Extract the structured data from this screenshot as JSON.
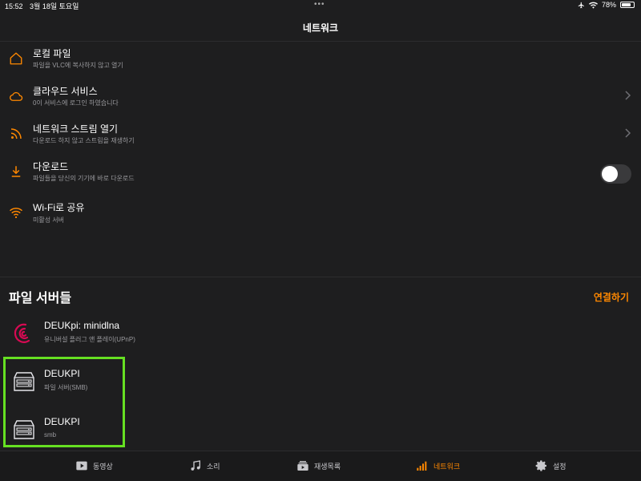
{
  "status_bar": {
    "time": "15:52",
    "date": "3월 18일 토요일",
    "dots": "•••",
    "battery_percent": "78%",
    "battery_level": 0.78
  },
  "header": {
    "title": "네트워크"
  },
  "menu": [
    {
      "label": "로컬 파일",
      "sub": "파일을 VLC에 복사하지 않고 열기",
      "icon": "home-icon",
      "chevron": false
    },
    {
      "label": "클라우드 서비스",
      "sub": "0이 서비스에 로그인 하였습니다",
      "icon": "cloud-icon",
      "chevron": true
    },
    {
      "label": "네트워크 스트림 열기",
      "sub": "다운로드 하지 않고 스트림을 재생하기",
      "icon": "rss-icon",
      "chevron": true
    },
    {
      "label": "다운로드",
      "sub": "파일들을 당신의 기기에 바로 다운로드",
      "icon": "download-icon",
      "chevron": true
    },
    {
      "label": "Wi-Fi로 공유",
      "sub": "미활성 서버",
      "icon": "wifi-icon",
      "toggle": false
    }
  ],
  "servers": {
    "title": "파일 서버들",
    "connect_label": "연결하기",
    "items": [
      {
        "name": "DEUKpi: minidlna",
        "sub": "유니버설 플러그 앤 플레이(UPnP)",
        "icon": "debian-icon"
      },
      {
        "name": "DEUKPI",
        "sub": "파일 서버(SMB)",
        "icon": "server-icon"
      },
      {
        "name": "DEUKPI",
        "sub": "smb",
        "icon": "server-icon"
      }
    ]
  },
  "tabs": [
    {
      "label": "동영상",
      "icon": "video-icon",
      "active": false
    },
    {
      "label": "소리",
      "icon": "music-icon",
      "active": false
    },
    {
      "label": "재생목록",
      "icon": "playlist-icon",
      "active": false
    },
    {
      "label": "네트워크",
      "icon": "network-icon",
      "active": true
    },
    {
      "label": "설정",
      "icon": "gear-icon",
      "active": false
    }
  ],
  "colors": {
    "accent": "#ff8800",
    "highlight": "#66e022",
    "background": "#1e1e1f"
  }
}
